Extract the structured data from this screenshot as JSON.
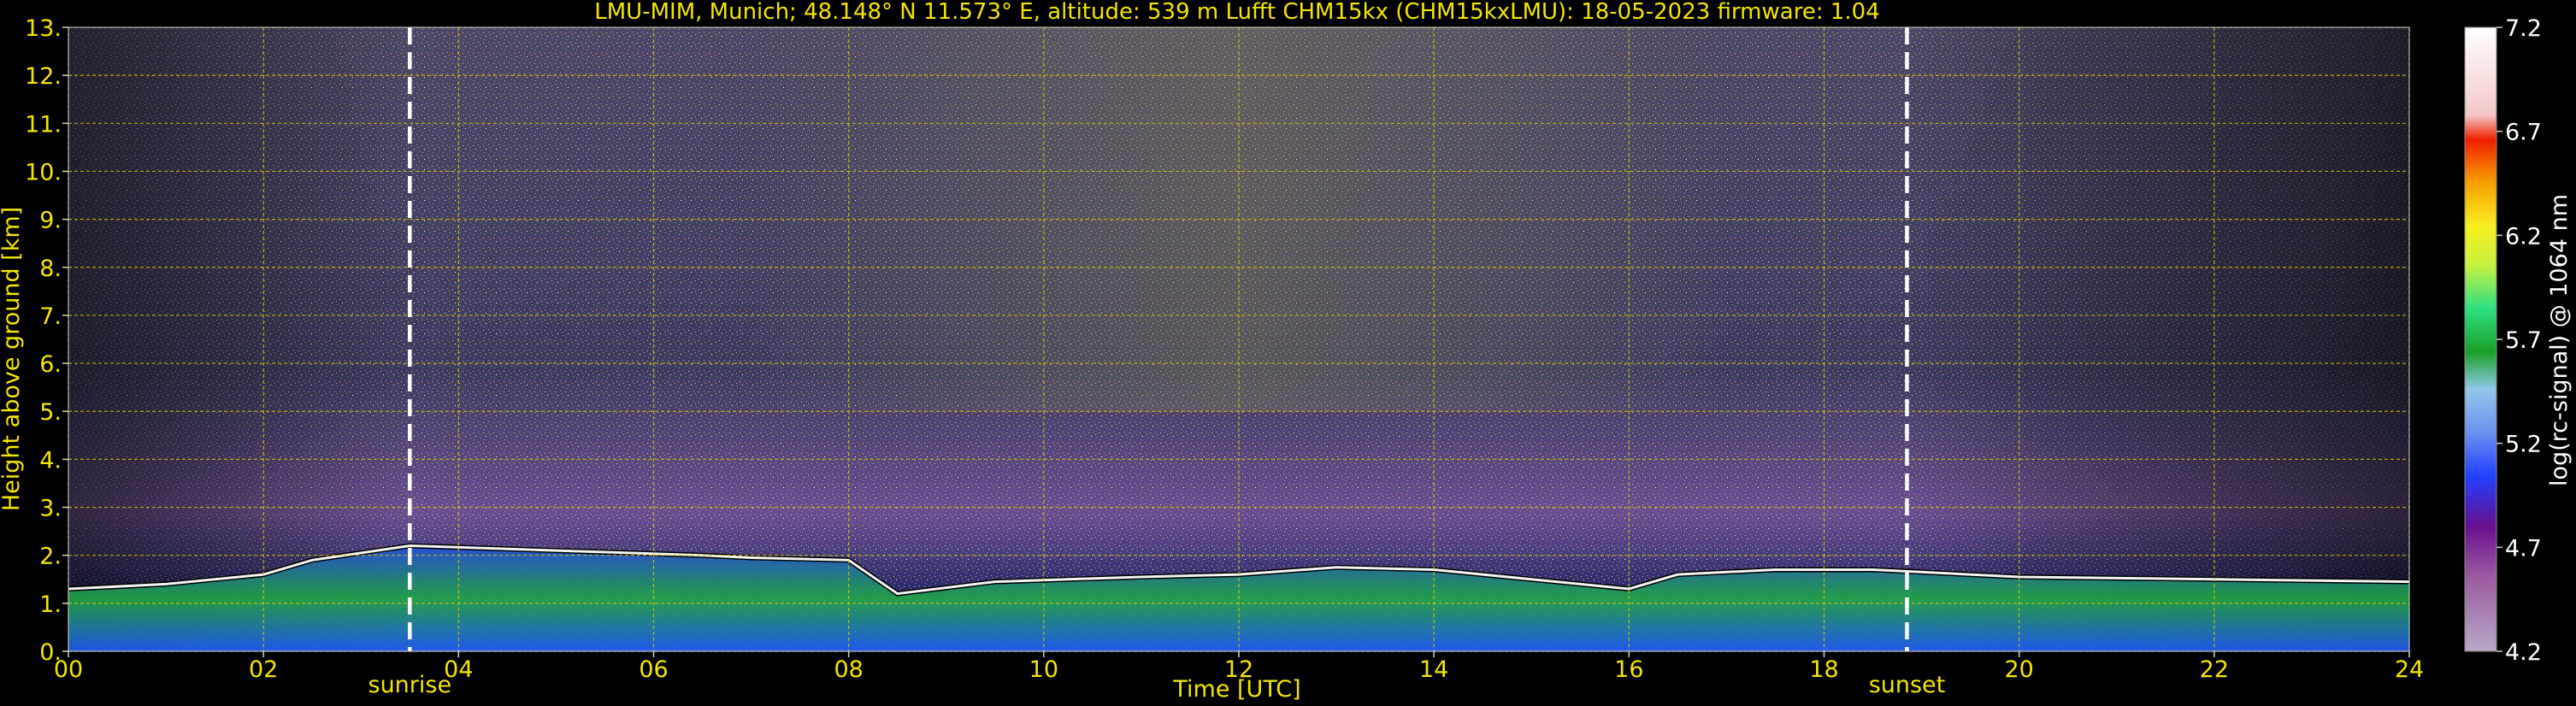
{
  "chart_data": {
    "type": "heatmap",
    "title": "LMU-MIM, Munich; 48.148° N 11.573° E, altitude: 539 m    Lufft CHM15kx (CHM15kxLMU): 18-05-2023    firmware: 1.04",
    "xlabel": "Time [UTC]",
    "ylabel": "Height above ground [km]",
    "xlim": [
      0,
      24
    ],
    "ylim": [
      0,
      13
    ],
    "x_ticks": [
      "00",
      "02",
      "04",
      "06",
      "08",
      "10",
      "12",
      "14",
      "16",
      "18",
      "20",
      "22",
      "24"
    ],
    "y_ticks": [
      "0.",
      "1.",
      "2.",
      "3.",
      "4.",
      "5.",
      "6.",
      "7.",
      "8.",
      "9.",
      "10.",
      "11.",
      "12.",
      "13."
    ],
    "grid": true,
    "annotations": [
      {
        "label": "sunrise",
        "x": 3.5
      },
      {
        "label": "sunset",
        "x": 18.85
      }
    ],
    "colorbar": {
      "label": "log(rc-signal) @ 1064 nm",
      "range": [
        4.2,
        7.2
      ],
      "ticks": [
        "4.2",
        "4.7",
        "5.2",
        "5.7",
        "6.2",
        "6.7",
        "7.2"
      ]
    },
    "boundary_layer_top_km": {
      "x": [
        0,
        1,
        2,
        2.5,
        3.5,
        6.5,
        7.0,
        8.0,
        8.5,
        9.5,
        11.0,
        12.0,
        13.0,
        14.0,
        15.0,
        16.0,
        16.5,
        17.5,
        18.5,
        20.0,
        22.0,
        24.0
      ],
      "y": [
        1.3,
        1.4,
        1.6,
        1.9,
        2.2,
        2.0,
        1.95,
        1.9,
        1.2,
        1.45,
        1.55,
        1.6,
        1.75,
        1.7,
        1.5,
        1.3,
        1.6,
        1.7,
        1.7,
        1.55,
        1.5,
        1.45
      ]
    }
  }
}
